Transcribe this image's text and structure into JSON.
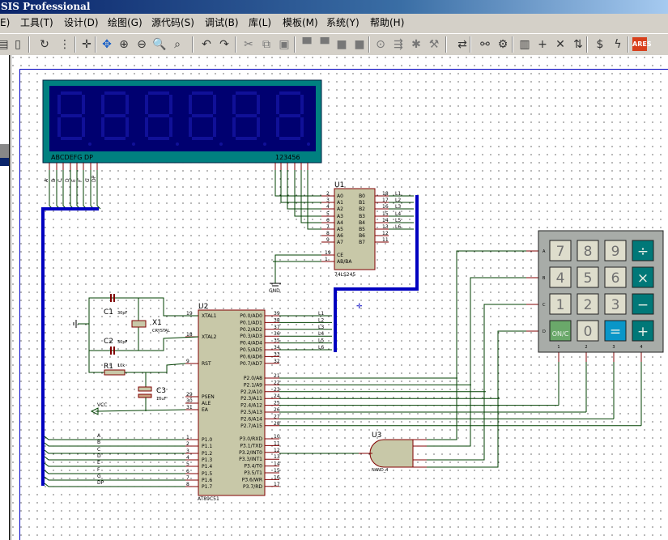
{
  "window": {
    "title": "SIS Professional"
  },
  "menu": [
    "E)",
    "工具(T)",
    "设计(D)",
    "绘图(G)",
    "源代码(S)",
    "调试(B)",
    "库(L)",
    "模板(M)",
    "系统(Y)",
    "帮助(H)"
  ],
  "toolbar": [
    {
      "icon": "print-icon",
      "g": "▤"
    },
    {
      "icon": "page-icon",
      "g": "▯"
    },
    {
      "icon": "refresh-icon",
      "g": "↻"
    },
    {
      "icon": "grid-icon",
      "g": "⋮"
    },
    {
      "icon": "origin-icon",
      "g": "✛"
    },
    {
      "icon": "pan-icon",
      "g": "✥"
    },
    {
      "icon": "zoom-in-icon",
      "g": "⊕"
    },
    {
      "icon": "zoom-out-icon",
      "g": "⊖"
    },
    {
      "icon": "zoom-all-icon",
      "g": "🔍"
    },
    {
      "icon": "zoom-area-icon",
      "g": "⌕"
    },
    {
      "icon": "undo-icon",
      "g": "↶"
    },
    {
      "icon": "redo-icon",
      "g": "↷"
    },
    {
      "icon": "cut-icon",
      "g": "✂"
    },
    {
      "icon": "copy-icon",
      "g": "⧉"
    },
    {
      "icon": "paste-icon",
      "g": "▣"
    },
    {
      "icon": "block-copy-icon",
      "g": "▀"
    },
    {
      "icon": "block-move-icon",
      "g": "▀"
    },
    {
      "icon": "block-rotate-icon",
      "g": "■"
    },
    {
      "icon": "block-delete-icon",
      "g": "■"
    },
    {
      "icon": "pick-device-icon",
      "g": "⊙"
    },
    {
      "icon": "make-device-icon",
      "g": "⇶"
    },
    {
      "icon": "package-icon",
      "g": "✱"
    },
    {
      "icon": "decompose-icon",
      "g": "⚒"
    },
    {
      "icon": "wire-autorouter-icon",
      "g": "⇄"
    },
    {
      "icon": "search-icon",
      "g": "⚯"
    },
    {
      "icon": "property-tool-icon",
      "g": "⚙"
    },
    {
      "icon": "new-sheet-icon",
      "g": "▥"
    },
    {
      "icon": "add-sheet-icon",
      "g": "+"
    },
    {
      "icon": "remove-sheet-icon",
      "g": "✕"
    },
    {
      "icon": "goto-child-icon",
      "g": "⇅"
    },
    {
      "icon": "bill-of-materials-icon",
      "g": "$"
    },
    {
      "icon": "electrical-check-icon",
      "g": "ϟ"
    },
    {
      "icon": "ares-icon",
      "g": "ARES"
    }
  ],
  "lcd": {
    "segments_label": "ABCDEFG  DP",
    "digits_label": "123456",
    "pin_labels": [
      "A",
      "B",
      "C",
      "D",
      "E",
      "F",
      "G",
      "DP"
    ]
  },
  "u1": {
    "ref": "U1",
    "part": "74LS245",
    "left": [
      [
        "2",
        "A0"
      ],
      [
        "3",
        "A1"
      ],
      [
        "4",
        "A2"
      ],
      [
        "5",
        "A3"
      ],
      [
        "6",
        "A4"
      ],
      [
        "7",
        "A5"
      ],
      [
        "8",
        "A6"
      ],
      [
        "9",
        "A7"
      ]
    ],
    "ctrl": [
      [
        "19",
        "CE"
      ],
      [
        "1",
        "AB/BA"
      ]
    ],
    "right": [
      [
        "18",
        "B0",
        "L1"
      ],
      [
        "17",
        "B1",
        "L2"
      ],
      [
        "16",
        "B2",
        "L3"
      ],
      [
        "15",
        "B3",
        "L4"
      ],
      [
        "14",
        "B4",
        "L5"
      ],
      [
        "13",
        "B5",
        "L6"
      ],
      [
        "12",
        "B6",
        ""
      ],
      [
        "11",
        "B7",
        ""
      ]
    ],
    "gnd": "GND"
  },
  "u2": {
    "ref": "U2",
    "part": "AT89C51",
    "left": [
      [
        "19",
        "XTAL1"
      ],
      [
        "18",
        "XTAL2"
      ],
      [
        "9",
        "RST"
      ],
      [
        "29",
        "PSEN"
      ],
      [
        "30",
        "ALE"
      ],
      [
        "31",
        "EA"
      ],
      [
        "1",
        "P1.0"
      ],
      [
        "2",
        "P1.1"
      ],
      [
        "3",
        "P1.2"
      ],
      [
        "4",
        "P1.3"
      ],
      [
        "5",
        "P1.4"
      ],
      [
        "6",
        "P1.5"
      ],
      [
        "7",
        "P1.6"
      ],
      [
        "8",
        "P1.7"
      ]
    ],
    "p0": [
      [
        "39",
        "P0.0/AD0",
        "L1"
      ],
      [
        "38",
        "P0.1/AD1",
        "L2"
      ],
      [
        "37",
        "P0.2/AD2",
        "L3"
      ],
      [
        "36",
        "P0.3/AD3",
        "L4"
      ],
      [
        "35",
        "P0.4/AD4",
        "L5"
      ],
      [
        "34",
        "P0.5/AD5",
        "L6"
      ],
      [
        "33",
        "P0.6/AD6",
        ""
      ],
      [
        "32",
        "P0.7/AD7",
        ""
      ]
    ],
    "p2": [
      [
        "21",
        "P2.0/A8"
      ],
      [
        "22",
        "P2.1/A9"
      ],
      [
        "23",
        "P2.2/A10"
      ],
      [
        "24",
        "P2.3/A11"
      ],
      [
        "25",
        "P2.4/A12"
      ],
      [
        "26",
        "P2.5/A13"
      ],
      [
        "27",
        "P2.6/A14"
      ],
      [
        "28",
        "P2.7/A15"
      ]
    ],
    "p3": [
      [
        "10",
        "P3.0/RXD"
      ],
      [
        "11",
        "P3.1/TXD"
      ],
      [
        "12",
        "P3.2/INT0"
      ],
      [
        "13",
        "P3.3/INT1"
      ],
      [
        "14",
        "P3.4/T0"
      ],
      [
        "15",
        "P3.5/T1"
      ],
      [
        "16",
        "P3.6/WR"
      ],
      [
        "17",
        "P3.7/RD"
      ]
    ],
    "p1_nets": [
      "A",
      "B",
      "C",
      "D",
      "E",
      "F",
      "G",
      "DP"
    ]
  },
  "components": {
    "c1": "C1",
    "c1v": "30pF",
    "c2": "C2",
    "c2v": "30pF",
    "x1": "X1",
    "x1v": "CRYSTAL",
    "r1": "R1",
    "r1v": "10k",
    "c3": "C3",
    "c3v": "10uF",
    "vcc": "VCC"
  },
  "u3": {
    "ref": "U3",
    "part": "NAND_4"
  },
  "keypad": {
    "rows": [
      "A",
      "B",
      "C",
      "D"
    ],
    "cols": [
      "1",
      "2",
      "3",
      "4"
    ],
    "keys": [
      [
        "7",
        "8",
        "9",
        "÷"
      ],
      [
        "4",
        "5",
        "6",
        "×"
      ],
      [
        "1",
        "2",
        "3",
        "−"
      ],
      [
        "ON/C",
        "0",
        "=",
        "+"
      ]
    ],
    "colors": {
      "num": "#deddcc",
      "op": "#007878",
      "on": "#6aa86a",
      "eq": "#0a96c8",
      "body": "#a8aca8"
    }
  },
  "colors": {
    "wire": "#004000",
    "pin": "#800000",
    "bus": "#0000c0",
    "chip": "#c8c8a8",
    "lcd_frame": "#008080",
    "lcd_glass": "#000070"
  }
}
